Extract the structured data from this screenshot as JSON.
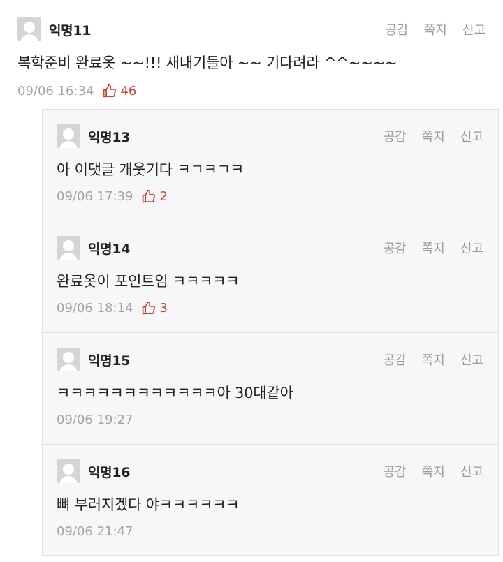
{
  "actions": {
    "empathy": "공감",
    "message": "쪽지",
    "report": "신고"
  },
  "colors": {
    "like": "#c8452f",
    "muted": "#a3a3a8",
    "reply_bg": "#f7f7f9"
  },
  "main_comment": {
    "nickname": "익명11",
    "text": "복학준비 완료옷 ~~!!! 새내기들아 ~~ 기다려라 ^^~~~~",
    "time": "09/06 16:34",
    "likes": "46",
    "like_icon": "thumbs-up-icon"
  },
  "replies": [
    {
      "nickname": "익명13",
      "text": "아 이댓글 개웃기다 ㅋㄱㅋㄱㅋ",
      "time": "09/06 17:39",
      "likes": "2"
    },
    {
      "nickname": "익명14",
      "text": "완료옷이 포인트임 ㅋㅋㅋㅋㅋ",
      "time": "09/06 18:14",
      "likes": "3"
    },
    {
      "nickname": "익명15",
      "text": "ㅋㅋㅋㅋㅋㅋㅋㅋㅋㅋㅋㅋ아 30대같아",
      "time": "09/06 19:27"
    },
    {
      "nickname": "익명16",
      "text": "뼈 부러지겠다 야ㅋㅋㅋㅋㅋㅋ",
      "time": "09/06 21:47"
    }
  ]
}
